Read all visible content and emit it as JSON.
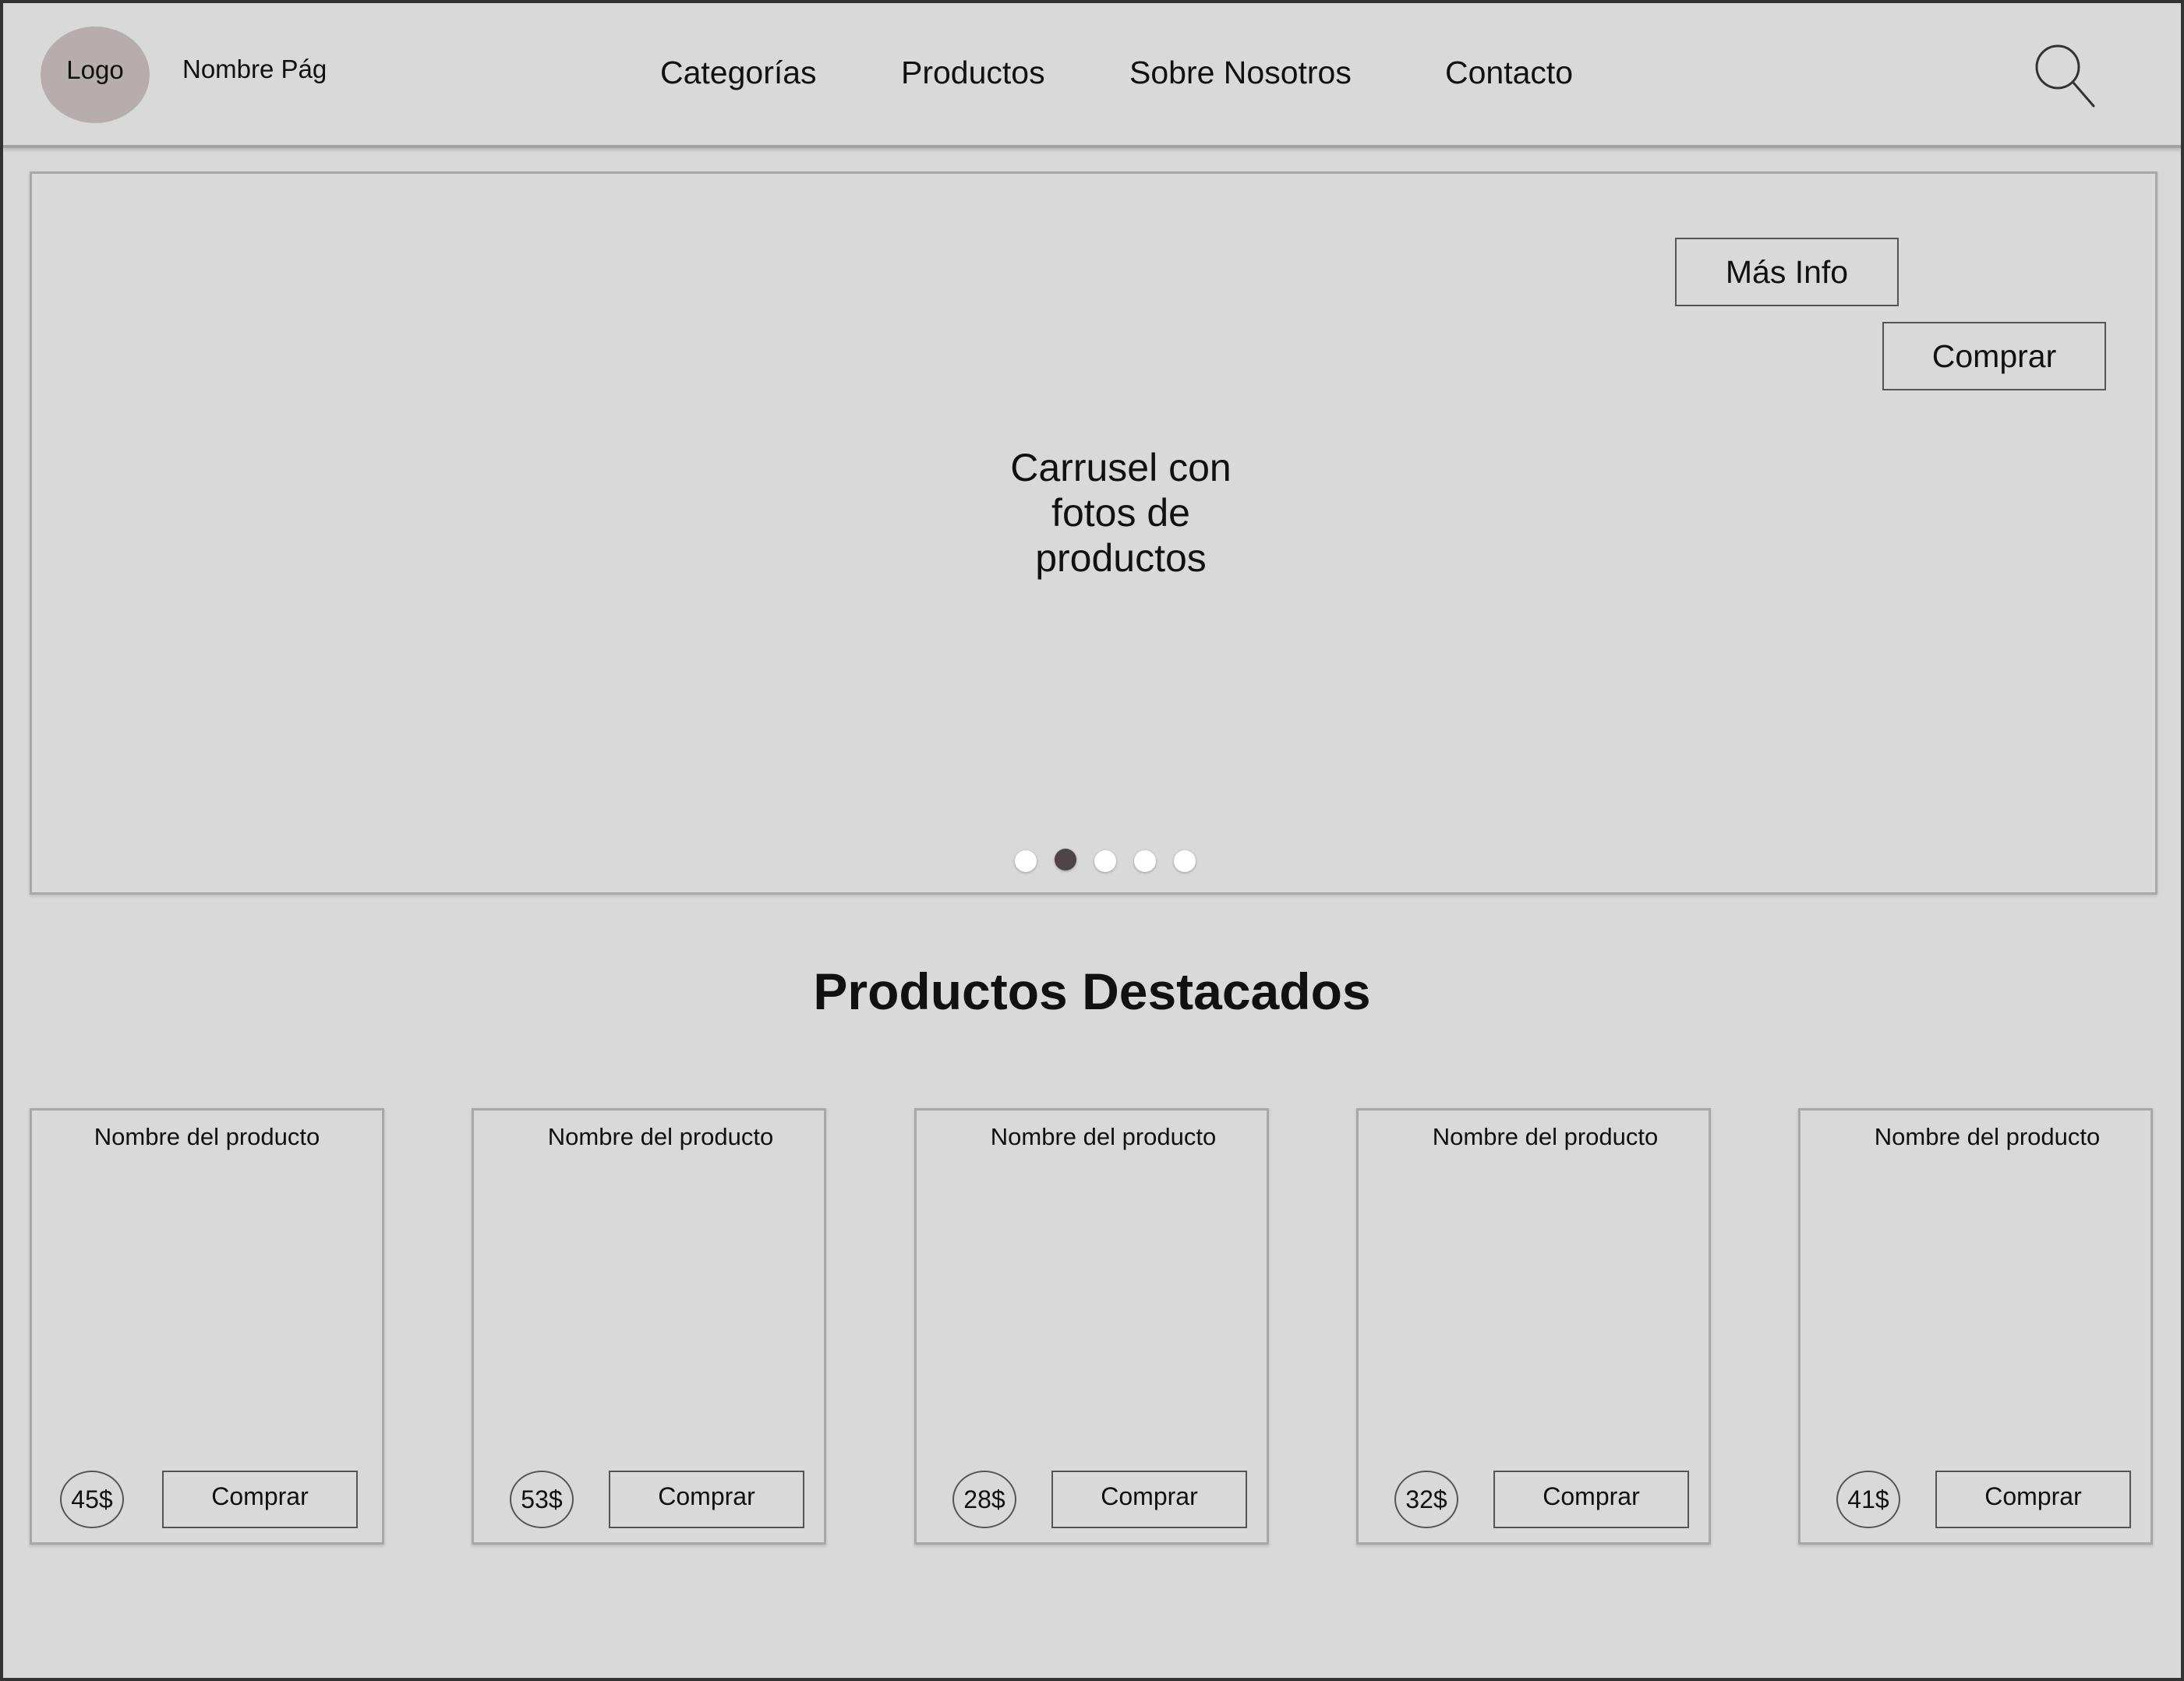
{
  "header": {
    "logo_label": "Logo",
    "site_name": "Nombre Pág",
    "nav": [
      "Categorías",
      "Productos",
      "Sobre Nosotros",
      "Contacto"
    ],
    "search_icon": "search-icon"
  },
  "hero": {
    "caption_lines": [
      "Carrusel con",
      "fotos de",
      "productos"
    ],
    "more_info_label": "Más Info",
    "buy_label": "Comprar",
    "slide_count": 5,
    "active_slide": 2
  },
  "featured": {
    "title": "Productos Destacados",
    "products": [
      {
        "name": "Nombre del producto",
        "price": "45$",
        "buy_label": "Comprar"
      },
      {
        "name": "Nombre del producto",
        "price": "53$",
        "buy_label": "Comprar"
      },
      {
        "name": "Nombre del producto",
        "price": "28$",
        "buy_label": "Comprar"
      },
      {
        "name": "Nombre del producto",
        "price": "32$",
        "buy_label": "Comprar"
      },
      {
        "name": "Nombre del producto",
        "price": "41$",
        "buy_label": "Comprar"
      }
    ]
  },
  "colors": {
    "background": "#d9d9d9",
    "logo": "#b8adae",
    "active_dot": "#4d4547",
    "inactive_dot": "#ffffff"
  }
}
